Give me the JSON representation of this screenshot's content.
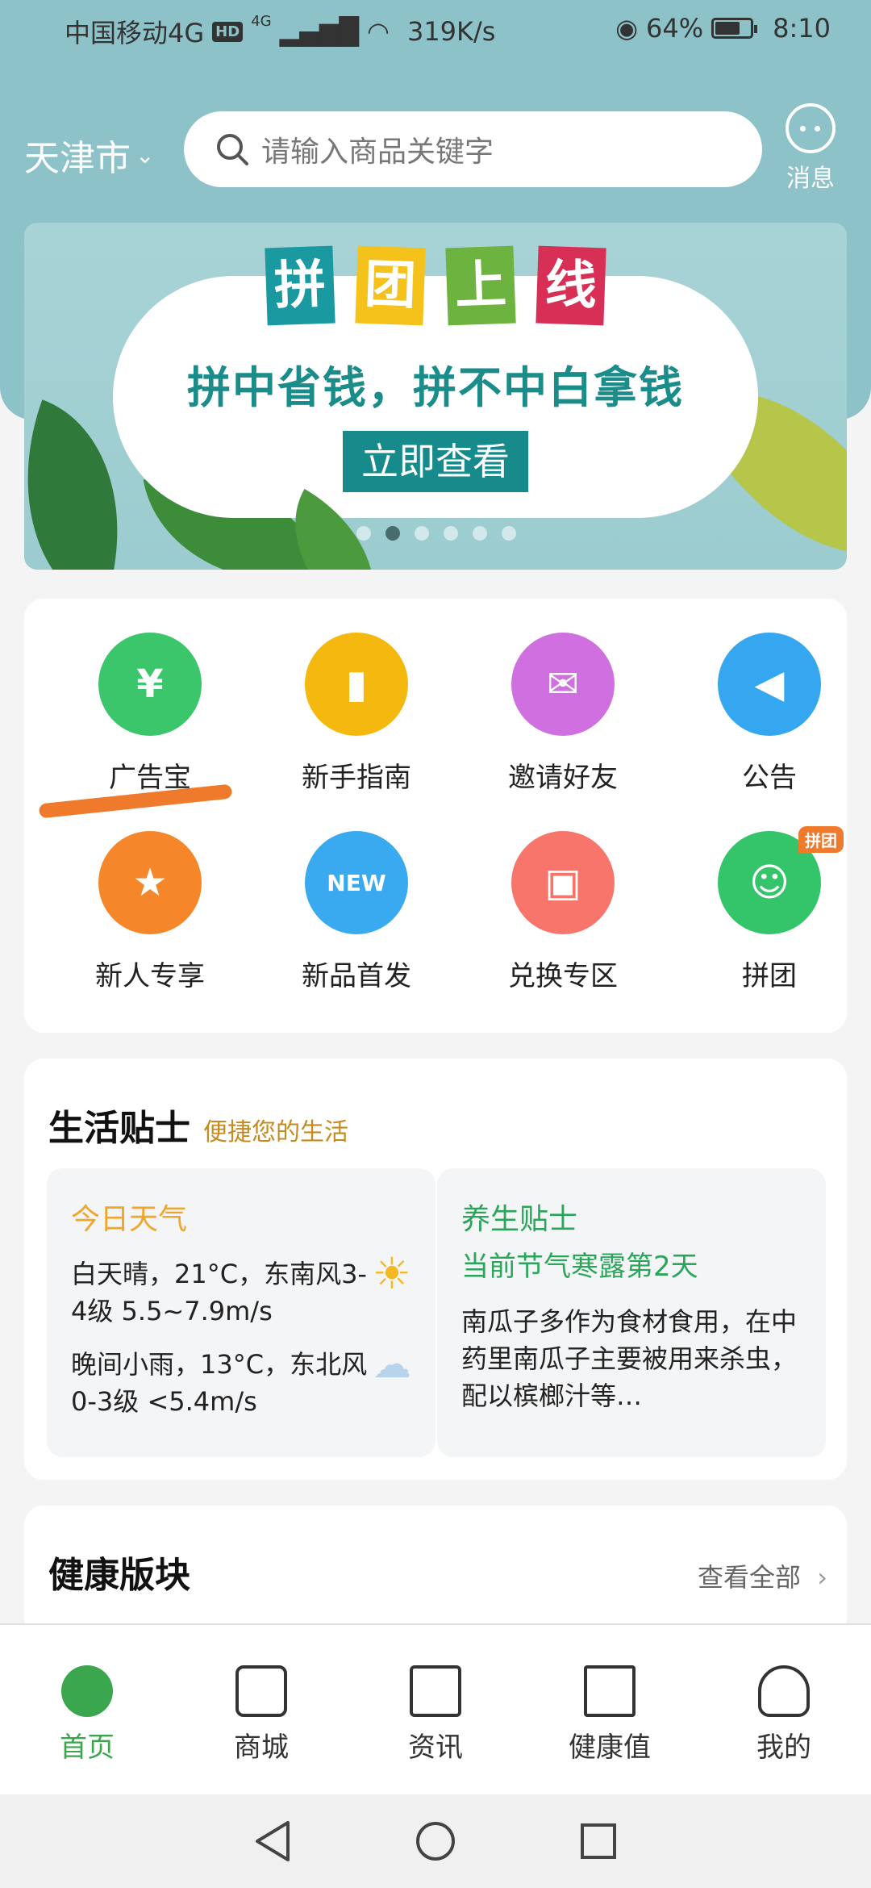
{
  "status_bar": {
    "carrier": "中国移动4G",
    "hd": "HD",
    "network": "4G",
    "speed": "319K/s",
    "battery": "64%",
    "time": "8:10"
  },
  "header": {
    "city": "天津市",
    "search_placeholder": "请输入商品关键字",
    "message_label": "消息"
  },
  "banner": {
    "title_chars": [
      "拼",
      "团",
      "上",
      "线"
    ],
    "title_colors": [
      "#1a9aa0",
      "#f4c21b",
      "#6db33f",
      "#d72f55"
    ],
    "subtitle": "拼中省钱，拼不中白拿钱",
    "button": "立即查看",
    "active_dot": 1,
    "dot_count": 6
  },
  "grid": {
    "items": [
      {
        "label": "广告宝",
        "icon": "money-bag-icon",
        "color": "#3cc66c"
      },
      {
        "label": "新手指南",
        "icon": "book-icon",
        "color": "#f5b80f"
      },
      {
        "label": "邀请好友",
        "icon": "envelope-icon",
        "color": "#d070e0"
      },
      {
        "label": "公告",
        "icon": "megaphone-icon",
        "color": "#35a7f0"
      },
      {
        "label": "新人专享",
        "icon": "star-icon",
        "color": "#f5862a"
      },
      {
        "label": "新品首发",
        "icon": "new-tag-icon",
        "color": "#3aaaf0"
      },
      {
        "label": "兑换专区",
        "icon": "gift-icon",
        "color": "#f7756b"
      },
      {
        "label": "拼团",
        "icon": "group-icon",
        "color": "#34c46a",
        "badge": "拼团"
      }
    ]
  },
  "tips": {
    "title": "生活贴士",
    "subtitle": "便捷您的生活",
    "weather": {
      "title": "今日天气",
      "day": "白天晴，21°C，东南风3-4级 5.5~7.9m/s",
      "night": "晚间小雨，13°C，东北风0-3级 <5.4m/s"
    },
    "health": {
      "title": "养生贴士",
      "subtitle": "当前节气寒露第2天",
      "body": "南瓜子多作为食材食用，在中药里南瓜子主要被用来杀虫，配以槟榔汁等…"
    }
  },
  "health_block": {
    "title": "健康版块",
    "more": "查看全部"
  },
  "tabbar": {
    "items": [
      {
        "label": "首页",
        "icon": "home-leaf-icon",
        "active": true
      },
      {
        "label": "商城",
        "icon": "store-icon"
      },
      {
        "label": "资讯",
        "icon": "news-icon"
      },
      {
        "label": "健康值",
        "icon": "health-star-icon"
      },
      {
        "label": "我的",
        "icon": "profile-icon"
      }
    ]
  },
  "colors": {
    "accent": "#3aa64d",
    "header_bg": "#8dc2c8",
    "tips_yellow": "#f0a52b",
    "tips_green": "#2aa55a"
  }
}
